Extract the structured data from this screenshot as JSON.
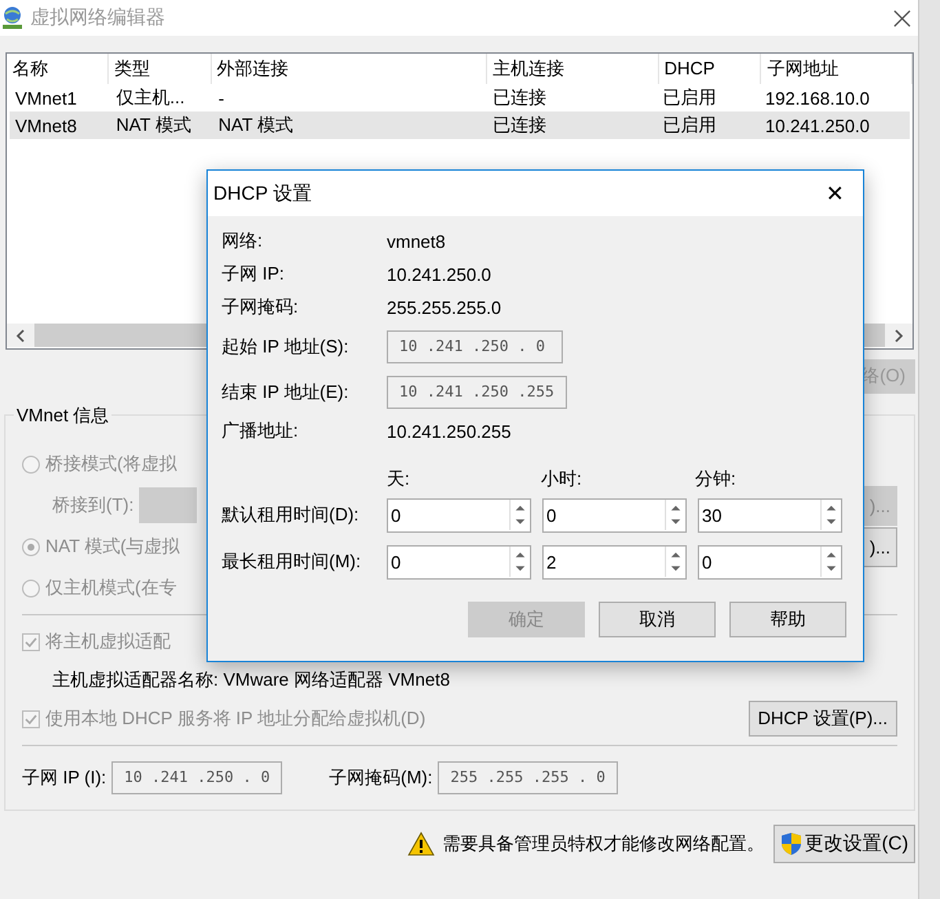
{
  "window": {
    "title": "虚拟网络编辑器"
  },
  "table": {
    "columns": [
      "名称",
      "类型",
      "外部连接",
      "主机连接",
      "DHCP",
      "子网地址"
    ],
    "rows": [
      {
        "cells": [
          "VMnet1",
          "仅主机...",
          "-",
          "已连接",
          "已启用",
          "192.168.10.0"
        ],
        "selected": false
      },
      {
        "cells": [
          "VMnet8",
          "NAT 模式",
          "NAT 模式",
          "已连接",
          "已启用",
          "10.241.250.0"
        ],
        "selected": true
      }
    ]
  },
  "side_button": "络(O)",
  "vmnet_info": {
    "title": "VMnet 信息",
    "bridge": {
      "label": "桥接模式(将虚拟",
      "selected": false,
      "disabled": true
    },
    "bridge_to": "桥接到(T):",
    "nat": {
      "label": "NAT 模式(与虚拟",
      "selected": true,
      "disabled": true
    },
    "host_only": {
      "label": "仅主机模式(在专",
      "selected": false,
      "disabled": true
    },
    "right_buttons": [
      ")...",
      ")..."
    ],
    "host_adapter": {
      "label": "将主机虚拟适配",
      "checked": true,
      "disabled": true
    },
    "adapter_name": "主机虚拟适配器名称: VMware 网络适配器 VMnet8",
    "dhcp_service": {
      "label": "使用本地 DHCP 服务将 IP 地址分配给虚拟机(D)",
      "checked": true,
      "disabled": true
    },
    "dhcp_button": "DHCP 设置(P)...",
    "subnet_ip": {
      "label": "子网 IP (I):",
      "value": "10 .241 .250 . 0"
    },
    "subnet_mask": {
      "label": "子网掩码(M):",
      "value": "255 .255 .255 . 0"
    }
  },
  "footer": {
    "warning": "需要具备管理员特权才能修改网络配置。",
    "button": "更改设置(C)"
  },
  "dialog": {
    "title": "DHCP 设置",
    "close": "✕",
    "info": [
      {
        "label": "网络:",
        "value": "vmnet8"
      },
      {
        "label": "子网 IP:",
        "value": "10.241.250.0"
      },
      {
        "label": "子网掩码:",
        "value": "255.255.255.0"
      }
    ],
    "start_ip": {
      "label": "起始 IP 地址(S):",
      "value": "10 .241 .250 . 0"
    },
    "end_ip": {
      "label": "结束 IP 地址(E):",
      "value": "10 .241 .250 .255"
    },
    "broadcast": {
      "label": "广播地址:",
      "value": "10.241.250.255"
    },
    "lease_headers": [
      "天:",
      "小时:",
      "分钟:"
    ],
    "leases": [
      {
        "label": "默认租用时间(D):",
        "values": [
          "0",
          "0",
          "30"
        ]
      },
      {
        "label": "最长租用时间(M):",
        "values": [
          "0",
          "2",
          "0"
        ]
      }
    ],
    "buttons": [
      {
        "label": "确定",
        "disabled": true
      },
      {
        "label": "取消",
        "disabled": false
      },
      {
        "label": "帮助",
        "disabled": false
      }
    ]
  }
}
